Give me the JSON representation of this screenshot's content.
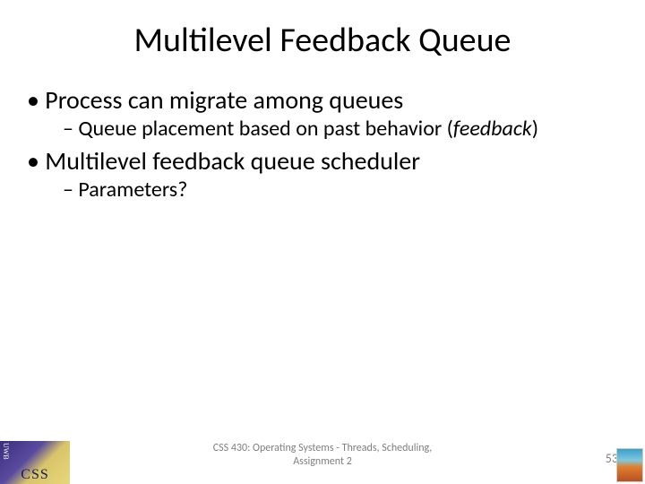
{
  "title": "Multilevel Feedback Queue",
  "bullets": {
    "b1": "Process can migrate among queues",
    "b1s1a": "Queue placement based on past behavior (",
    "b1s1b": "feedback",
    "b1s1c": ")",
    "b2": "Multilevel feedback queue scheduler",
    "b2s1": "Parameters?"
  },
  "footer": {
    "line1": "CSS 430: Operating Systems - Threads, Scheduling,",
    "line2": "Assignment 2"
  },
  "page_number": "53",
  "logo_text": "CSS"
}
